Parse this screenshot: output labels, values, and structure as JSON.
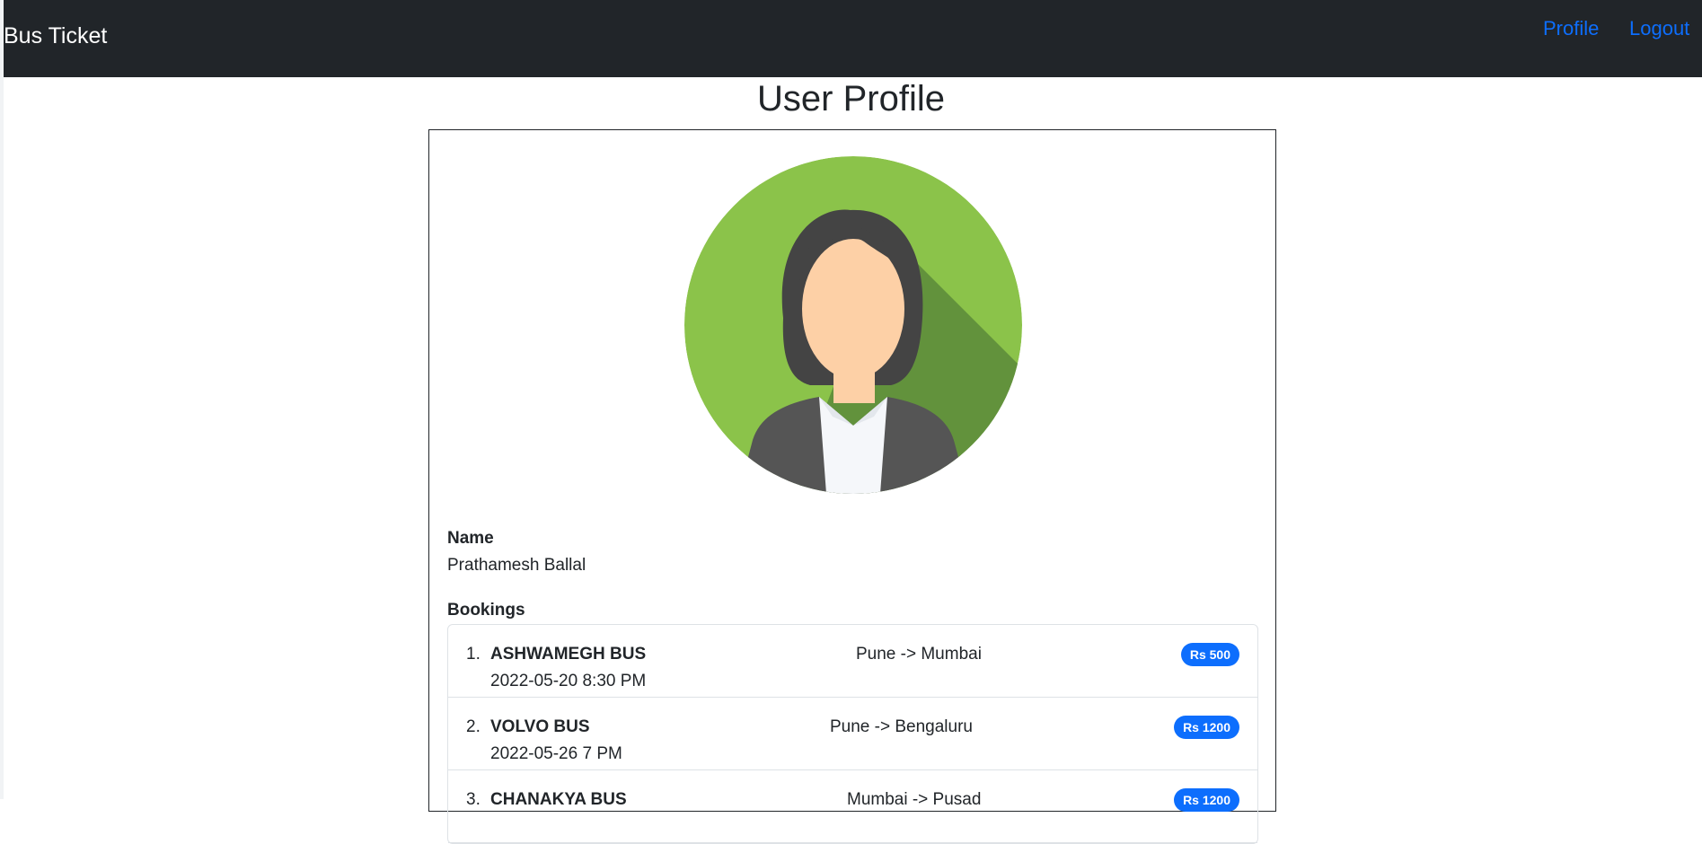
{
  "navbar": {
    "brand": "Bus Ticket",
    "links": {
      "profile": "Profile",
      "logout": "Logout"
    }
  },
  "page": {
    "title": "User Profile"
  },
  "profile": {
    "name_label": "Name",
    "name_value": "Prathamesh Ballal",
    "bookings_label": "Bookings"
  },
  "bookings": [
    {
      "index": "1.",
      "bus": "ASHWAMEGH BUS",
      "datetime": "2022-05-20 8:30 PM",
      "route": "Pune -> Mumbai",
      "price": "Rs 500"
    },
    {
      "index": "2.",
      "bus": "VOLVO BUS",
      "datetime": "2022-05-26 7 PM",
      "route": "Pune -> Bengaluru",
      "price": "Rs 1200"
    },
    {
      "index": "3.",
      "bus": "CHANAKYA BUS",
      "datetime": "",
      "route": "Mumbai -> Pusad",
      "price": "Rs 1200"
    }
  ],
  "colors": {
    "navbar_bg": "#212529",
    "link": "#0d6efd",
    "badge": "#0d6efd",
    "avatar_bg": "#8bc34a"
  },
  "icons": {
    "avatar": "female-user-avatar-icon"
  }
}
